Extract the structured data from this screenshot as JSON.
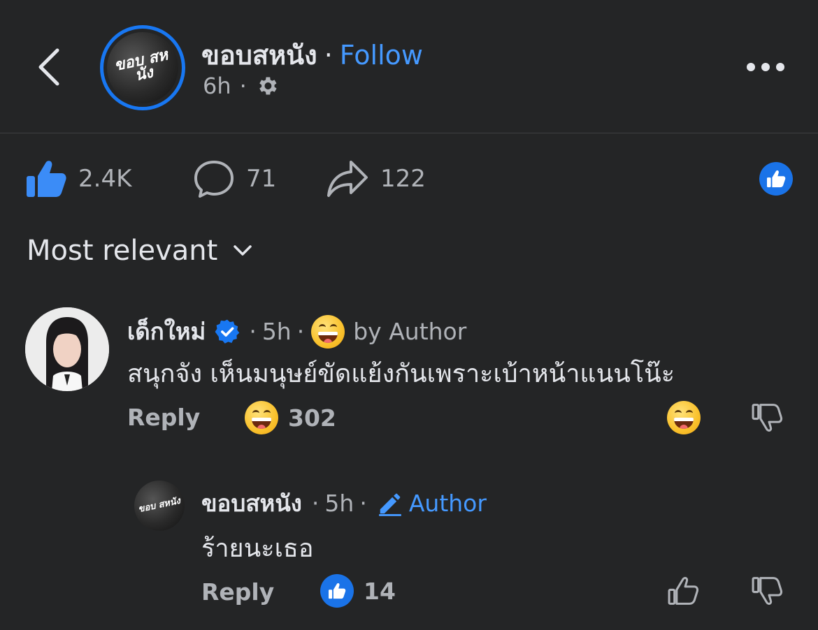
{
  "header": {
    "back_icon": "chevron-left-icon",
    "page_avatar_text": "ขอบ สหนัง",
    "page_name": "ขอบสหนัง",
    "separator": "·",
    "follow_label": "Follow",
    "time": "6h",
    "meta_separator": "·",
    "privacy_icon": "gear-icon",
    "more_icon": "more-horizontal-icon"
  },
  "stats": {
    "likes": "2.4K",
    "comments": "71",
    "shares": "122",
    "like_icon": "thumbs-up-icon",
    "comment_icon": "comment-bubble-icon",
    "share_icon": "share-arrow-icon",
    "reaction_badge_icon": "like-badge-icon"
  },
  "sort": {
    "label": "Most relevant",
    "icon": "chevron-down-icon"
  },
  "comments": [
    {
      "author": "เด็กใหม่",
      "verified": true,
      "separator": "·",
      "time": "5h",
      "reaction_by_author_text": "by Author",
      "text": "สนุกจัง เห็นมนุษย์ขัดแย้งกันเพราะเบ้าหน้าแนนโน๊ะ",
      "reply_label": "Reply",
      "reaction_count": "302",
      "colors": {
        "verified": "#1877f2"
      }
    }
  ],
  "replies": [
    {
      "author": "ขอบสหนัง",
      "avatar_text": "ขอบ สหนัง",
      "separator": "·",
      "time": "5h",
      "author_badge": "Author",
      "text": "ร้ายนะเธอ",
      "reply_label": "Reply",
      "like_count": "14"
    }
  ],
  "colors": {
    "background": "#242526",
    "accent": "#4599ff",
    "like_blue": "#1a73e8",
    "text": "#e4e6eb",
    "muted": "#b0b3b8"
  }
}
